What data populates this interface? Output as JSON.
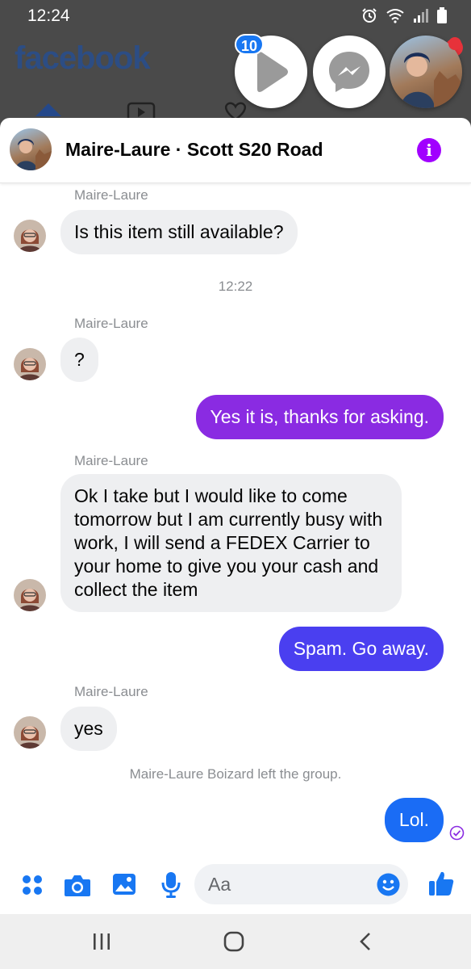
{
  "status_bar": {
    "time": "12:24"
  },
  "facebook": {
    "logo": "facebook"
  },
  "chat_heads": {
    "video_badge": "10"
  },
  "chat": {
    "title": "Maire-Laure · Scott S20 Road",
    "messages": [
      {
        "sender": "Maire-Laure",
        "text": "Is this item still available?"
      },
      {
        "timestamp": "12:22"
      },
      {
        "sender": "Maire-Laure",
        "text": "?"
      },
      {
        "outgoing": true,
        "text": "Yes it is, thanks for asking."
      },
      {
        "sender": "Maire-Laure",
        "text": "Ok I take but I would like to come tomorrow but I am currently busy with work, I will send a FEDEX Carrier to your home to give you your cash and collect the item"
      },
      {
        "outgoing": true,
        "text": "Spam. Go away."
      },
      {
        "sender": "Maire-Laure",
        "text": "yes"
      },
      {
        "event": "Maire-Laure Boizard left the group."
      },
      {
        "outgoing": true,
        "text": "Lol."
      }
    ]
  },
  "composer": {
    "placeholder": "Aa"
  },
  "colors": {
    "accent_purple": "#a100ff",
    "messenger_blue": "#1877f2",
    "bubble_purple": "#8a2be2",
    "bubble_indigo": "#4a3ff0",
    "bubble_blue": "#1a6cf5"
  }
}
